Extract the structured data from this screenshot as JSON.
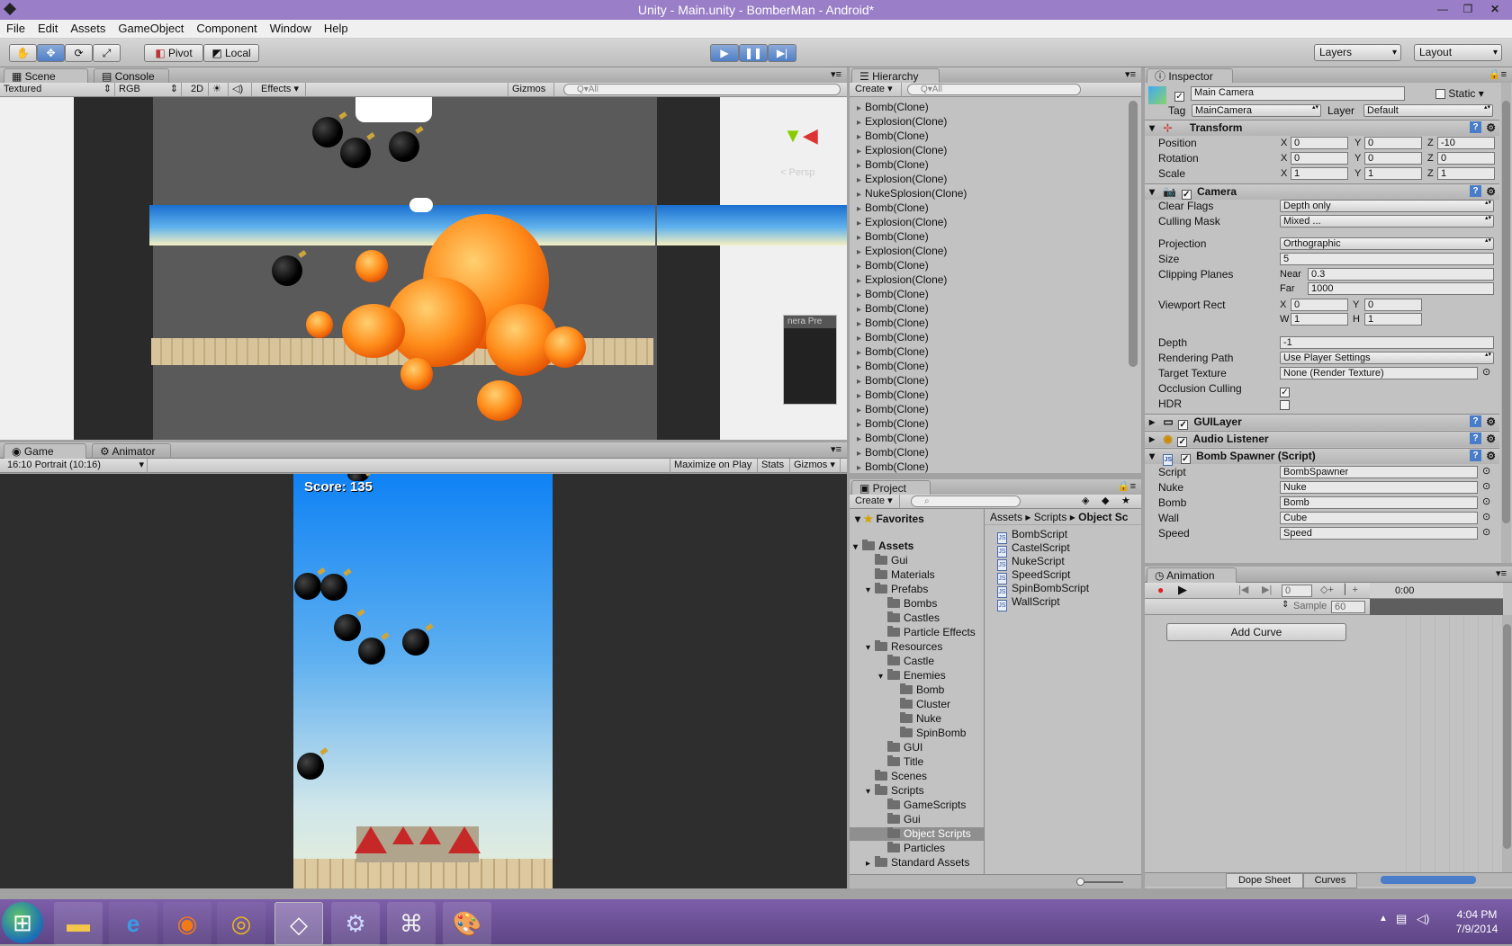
{
  "window": {
    "title": "Unity - Main.unity - BomberMan - Android*"
  },
  "menu": [
    "File",
    "Edit",
    "Assets",
    "GameObject",
    "Component",
    "Window",
    "Help"
  ],
  "toolbar": {
    "pivot": "Pivot",
    "local": "Local",
    "layers": "Layers",
    "layout": "Layout"
  },
  "scene": {
    "tabs": [
      "Scene",
      "Console"
    ],
    "shading": "Textured",
    "render_mode": "RGB",
    "mode_2d": "2D",
    "effects": "Effects",
    "gizmos": "Gizmos",
    "search_placeholder": "Q▾All",
    "persp_label": "< Persp",
    "camera_preview_label": "nera Pre"
  },
  "game": {
    "tabs": [
      "Game",
      "Animator"
    ],
    "aspect": "16:10 Portrait (10:16)",
    "maximize": "Maximize on Play",
    "stats": "Stats",
    "gizmos": "Gizmos",
    "score_text": "Score: 135"
  },
  "hierarchy": {
    "tab": "Hierarchy",
    "create": "Create",
    "search_placeholder": "Q▾All",
    "items": [
      "Bomb(Clone)",
      "Explosion(Clone)",
      "Bomb(Clone)",
      "Explosion(Clone)",
      "Bomb(Clone)",
      "Explosion(Clone)",
      "NukeSplosion(Clone)",
      "Bomb(Clone)",
      "Explosion(Clone)",
      "Bomb(Clone)",
      "Explosion(Clone)",
      "Bomb(Clone)",
      "Explosion(Clone)",
      "Bomb(Clone)",
      "Bomb(Clone)",
      "Bomb(Clone)",
      "Bomb(Clone)",
      "Bomb(Clone)",
      "Bomb(Clone)",
      "Bomb(Clone)",
      "Bomb(Clone)",
      "Bomb(Clone)",
      "Bomb(Clone)",
      "Bomb(Clone)",
      "Bomb(Clone)",
      "Bomb(Clone)"
    ]
  },
  "project": {
    "tab": "Project",
    "create": "Create",
    "favorites": "Favorites",
    "tree": [
      {
        "label": "Assets",
        "indent": 0,
        "bold": true,
        "arrow": "▾"
      },
      {
        "label": "Gui",
        "indent": 1
      },
      {
        "label": "Materials",
        "indent": 1
      },
      {
        "label": "Prefabs",
        "indent": 1,
        "arrow": "▾"
      },
      {
        "label": "Bombs",
        "indent": 2
      },
      {
        "label": "Castles",
        "indent": 2
      },
      {
        "label": "Particle Effects",
        "indent": 2
      },
      {
        "label": "Resources",
        "indent": 1,
        "arrow": "▾"
      },
      {
        "label": "Castle",
        "indent": 2
      },
      {
        "label": "Enemies",
        "indent": 2,
        "arrow": "▾"
      },
      {
        "label": "Bomb",
        "indent": 3
      },
      {
        "label": "Cluster",
        "indent": 3
      },
      {
        "label": "Nuke",
        "indent": 3
      },
      {
        "label": "SpinBomb",
        "indent": 3
      },
      {
        "label": "GUI",
        "indent": 2
      },
      {
        "label": "Title",
        "indent": 2
      },
      {
        "label": "Scenes",
        "indent": 1
      },
      {
        "label": "Scripts",
        "indent": 1,
        "arrow": "▾"
      },
      {
        "label": "GameScripts",
        "indent": 2
      },
      {
        "label": "Gui",
        "indent": 2
      },
      {
        "label": "Object Scripts",
        "indent": 2,
        "selected": true
      },
      {
        "label": "Particles",
        "indent": 2
      },
      {
        "label": "Standard Assets",
        "indent": 1,
        "arrow": "▸"
      }
    ],
    "breadcrumb": [
      "Assets",
      "Scripts",
      "Object Sc"
    ],
    "files": [
      "BombScript",
      "CastelScript",
      "NukeScript",
      "SpeedScript",
      "SpinBombScript",
      "WallScript"
    ]
  },
  "inspector": {
    "tab": "Inspector",
    "object_name": "Main Camera",
    "static_label": "Static",
    "tag_label": "Tag",
    "tag_value": "MainCamera",
    "layer_label": "Layer",
    "layer_value": "Default",
    "transform": {
      "title": "Transform",
      "position_label": "Position",
      "position": [
        "0",
        "0",
        "-10"
      ],
      "rotation_label": "Rotation",
      "rotation": [
        "0",
        "0",
        "0"
      ],
      "scale_label": "Scale",
      "scale": [
        "1",
        "1",
        "1"
      ]
    },
    "camera": {
      "title": "Camera",
      "clear_flags_label": "Clear Flags",
      "clear_flags": "Depth only",
      "culling_mask_label": "Culling Mask",
      "culling_mask": "Mixed ...",
      "projection_label": "Projection",
      "projection": "Orthographic",
      "size_label": "Size",
      "size": "5",
      "clipping_label": "Clipping Planes",
      "near_label": "Near",
      "near": "0.3",
      "far_label": "Far",
      "far": "1000",
      "viewport_label": "Viewport Rect",
      "vx": "0",
      "vy": "0",
      "vw": "1",
      "vh": "1",
      "depth_label": "Depth",
      "depth": "-1",
      "rendering_label": "Rendering Path",
      "rendering": "Use Player Settings",
      "target_label": "Target Texture",
      "target": "None (Render Texture)",
      "occlusion_label": "Occlusion Culling",
      "hdr_label": "HDR"
    },
    "guilayer": "GUILayer",
    "audio_listener": "Audio Listener",
    "bomb_spawner": {
      "title": "Bomb Spawner (Script)",
      "rows": [
        {
          "label": "Script",
          "value": "BombSpawner"
        },
        {
          "label": "Nuke",
          "value": "Nuke"
        },
        {
          "label": "Bomb",
          "value": "Bomb"
        },
        {
          "label": "Wall",
          "value": "Cube"
        },
        {
          "label": "Speed",
          "value": "Speed"
        }
      ]
    }
  },
  "animation": {
    "tab": "Animation",
    "frame": "0",
    "sample_label": "Sample",
    "sample": "60",
    "time": "0:00",
    "add_curve": "Add Curve",
    "dope_sheet": "Dope Sheet",
    "curves": "Curves"
  },
  "taskbar": {
    "time": "4:04 PM",
    "date": "7/9/2014"
  },
  "colors": {
    "title_bg": "#9a7ec8",
    "taskbar_bg": "#6d4f97",
    "sky": "#1d8bf0",
    "play_blue": "#4f7fc7"
  }
}
